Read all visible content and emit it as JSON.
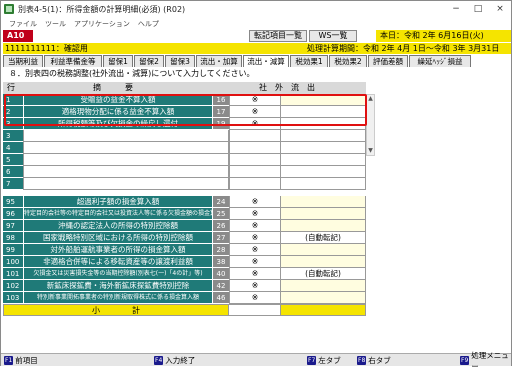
{
  "window": {
    "title": "別表4-5(1)：所得金額の計算明細(必須) (R02)",
    "buttons": [
      "−",
      "□",
      "×"
    ]
  },
  "menu": [
    "ファイル",
    "ツール",
    "アプリケーション",
    "ヘルプ"
  ],
  "header": {
    "code": "A10",
    "btn_transfer": "転記項目一覧",
    "btn_ws": "WS一覧",
    "today": "本日：令和 2年 6月16日(火)",
    "company": "1111111111：確認用",
    "period": "処理計算期間：令和 2年 4月 1日～令和 3年 3月31日"
  },
  "tabs": [
    "当期利益",
    "利益準備金等",
    "留保1",
    "留保2",
    "留保3",
    "流出・加算",
    "流出・減算",
    "税効果1",
    "税効果2",
    "評価差額",
    "繰延ﾍｯｼﾞ損益"
  ],
  "active_tab": 6,
  "instruction": "８．別表四の税務調整(社外流出・減算)について入力してください。",
  "table": {
    "head_row": "行",
    "head_label": "摘　　　要",
    "head_value": "社　外　流　出",
    "rows": [
      {
        "no": "1",
        "label": "受贈益の益金不算入額",
        "code": "16",
        "mark": "※",
        "value": ""
      },
      {
        "no": "2",
        "label": "適格現物分配に係る益金不算入額",
        "code": "17",
        "mark": "※",
        "value": ""
      },
      {
        "no": "3",
        "label": "所得税額等及び欠損金の繰戻し還付",
        "code": "19",
        "mark": "※",
        "value": ""
      },
      {
        "no": "3",
        "label": "",
        "code": "",
        "mark": "",
        "value": ""
      },
      {
        "no": "4",
        "label": "",
        "code": "",
        "mark": "",
        "value": ""
      },
      {
        "no": "5",
        "label": "",
        "code": "",
        "mark": "",
        "value": ""
      },
      {
        "no": "6",
        "label": "",
        "code": "",
        "mark": "",
        "value": ""
      },
      {
        "no": "7",
        "label": "",
        "code": "",
        "mark": "",
        "value": ""
      }
    ],
    "rows2": [
      {
        "no": "95",
        "label": "超過利子額の損金算入額",
        "code": "24",
        "mark": "※",
        "value": ""
      },
      {
        "no": "96",
        "label": "特定目的会社等の特定目的会社又は投資法人等に係る欠損金額の損金算入",
        "code": "25",
        "mark": "※",
        "value": ""
      },
      {
        "no": "97",
        "label": "沖縄の認定法人の所得の特別控除額",
        "code": "26",
        "mark": "※",
        "value": ""
      },
      {
        "no": "98",
        "label": "国家戦略特別区域における所得の特別控除額",
        "code": "27",
        "mark": "※",
        "value": "(自動転記)"
      },
      {
        "no": "99",
        "label": "対外船舶運航事業者の所得の損金算入額",
        "code": "28",
        "mark": "※",
        "value": ""
      },
      {
        "no": "100",
        "label": "非適格合併等による移転資産等の譲渡利益額",
        "code": "38",
        "mark": "※",
        "value": ""
      },
      {
        "no": "101",
        "label": "欠損金又は災害損失金等の当期控除額(別表七(一)「4の計」等)",
        "code": "40",
        "mark": "※",
        "value": "(自動転記)"
      },
      {
        "no": "102",
        "label": "新鉱床探鉱費・海外新鉱床探鉱費特別控除",
        "code": "42",
        "mark": "※",
        "value": ""
      },
      {
        "no": "103",
        "label": "特別新事業開拓事業者の特別新規取得株式に係る損金算入額",
        "code": "46",
        "mark": "※",
        "value": ""
      }
    ],
    "subtotal_label": "小　　　　計"
  },
  "fkeys": [
    {
      "key": "F1",
      "label": "前項目"
    },
    {
      "key": "F4",
      "label": "入力終了"
    },
    {
      "key": "F7",
      "label": "左タブ"
    },
    {
      "key": "F8",
      "label": "右タブ"
    },
    {
      "key": "F9",
      "label": "処理メニュー"
    }
  ],
  "colors": {
    "accent": "#1f7a78",
    "yellow": "#f5e400",
    "red": "#c0001a",
    "highlight": "#e01010"
  }
}
